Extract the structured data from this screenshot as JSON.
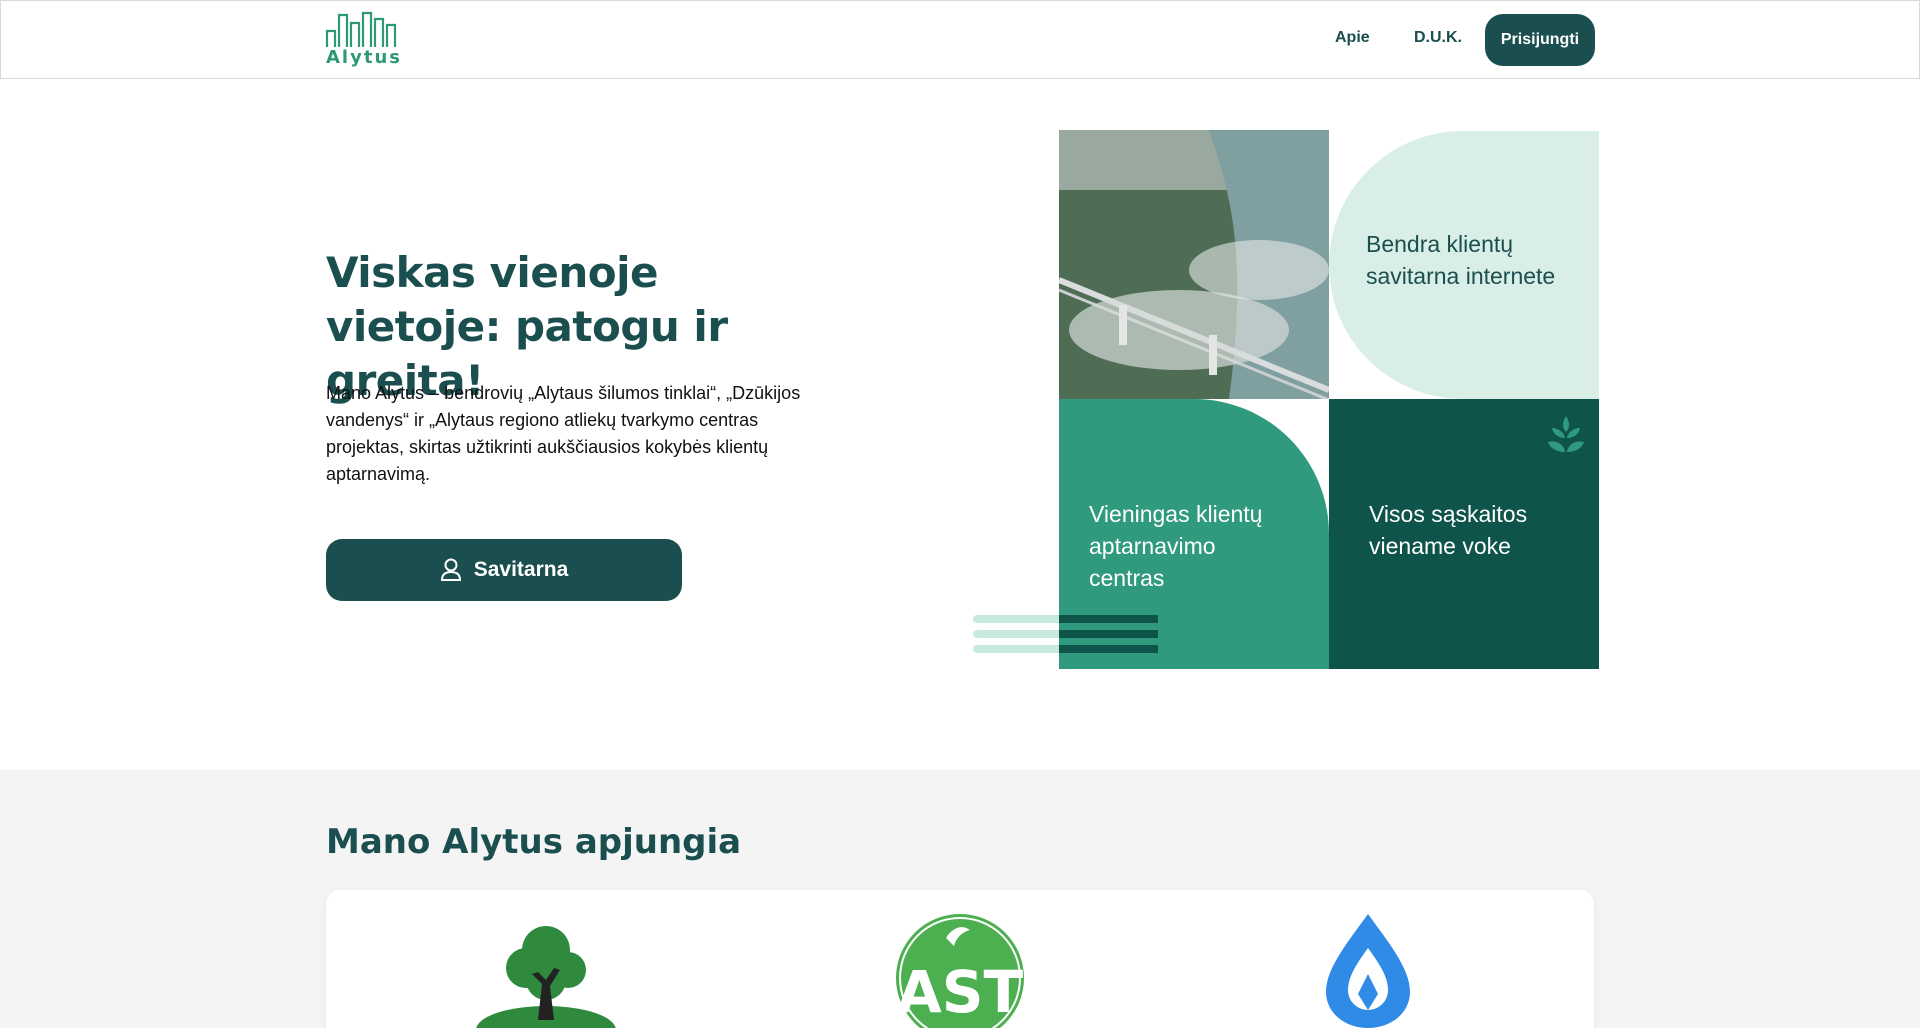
{
  "header": {
    "logo_text": "Alytus",
    "nav": {
      "about": "Apie",
      "faq": "D.U.K."
    },
    "login_label": "Prisijungti"
  },
  "hero": {
    "title": "Viskas vienoje vietoje: patogu ir greita!",
    "description": "Mano Alytus – bendrovių „Alytaus šilumos tinklai“, „Dzūkijos vandenys“ ir „Alytaus regiono atliekų tvarkymo centras projektas, skirtas užtikrinti aukščiausios kokybės klientų aptarnavimą.",
    "cta_label": "Savitarna"
  },
  "collage": {
    "tile_light": "Bendra klientų savitarna internete",
    "tile_mid": "Vieningas klientų aptarnavimo centras",
    "tile_dark": "Visos sąskaitos viename voke"
  },
  "partners": {
    "title": "Mano Alytus apjungia",
    "logos": [
      "tree-logo",
      "ast-logo",
      "water-drop-logo"
    ]
  },
  "colors": {
    "primary": "#1b4f4f",
    "accent_green": "#2f9a7d",
    "dark_teal": "#0e544b",
    "light_mint": "#d9eee6"
  }
}
